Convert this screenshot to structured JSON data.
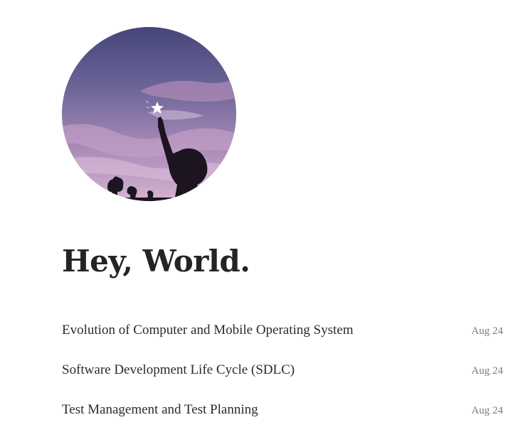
{
  "profile": {
    "avatar_icon": "profile-photo-silhouette-reaching-star",
    "heading": "Hey, World."
  },
  "posts": [
    {
      "title": "Evolution of Computer and Mobile Operating System",
      "date": "Aug 24"
    },
    {
      "title": "Software Development Life Cycle (SDLC)",
      "date": "Aug 24"
    },
    {
      "title": "Test Management and Test Planning",
      "date": "Aug 24"
    }
  ],
  "colors": {
    "heading": "#242424",
    "post_title": "#2b2b2b",
    "post_date": "#7a7a7a",
    "sky_top": "#4b4a7e",
    "sky_bottom": "#c9a6c8"
  }
}
